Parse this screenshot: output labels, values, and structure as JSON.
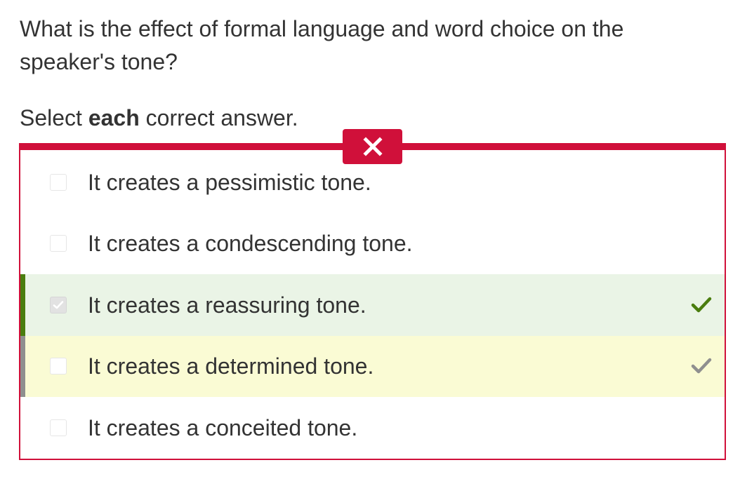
{
  "question": {
    "text": "What is the effect of formal language and word choice on the speaker's tone?"
  },
  "instruction": {
    "prefix": "Select ",
    "emphasis": "each",
    "suffix": " correct answer."
  },
  "result": {
    "status": "incorrect",
    "icon": "close-icon",
    "color": "#d0103a"
  },
  "options": [
    {
      "label": "It creates a pessimistic tone.",
      "selected": false,
      "state": "none"
    },
    {
      "label": "It creates a condescending tone.",
      "selected": false,
      "state": "none"
    },
    {
      "label": "It creates a reassuring tone.",
      "selected": true,
      "state": "correct",
      "icon": "check-icon",
      "color": "#4a7d0e"
    },
    {
      "label": "It creates a determined tone.",
      "selected": false,
      "state": "missed",
      "icon": "check-icon",
      "color": "#8f8f8f"
    },
    {
      "label": "It creates a conceited tone.",
      "selected": false,
      "state": "none"
    }
  ]
}
